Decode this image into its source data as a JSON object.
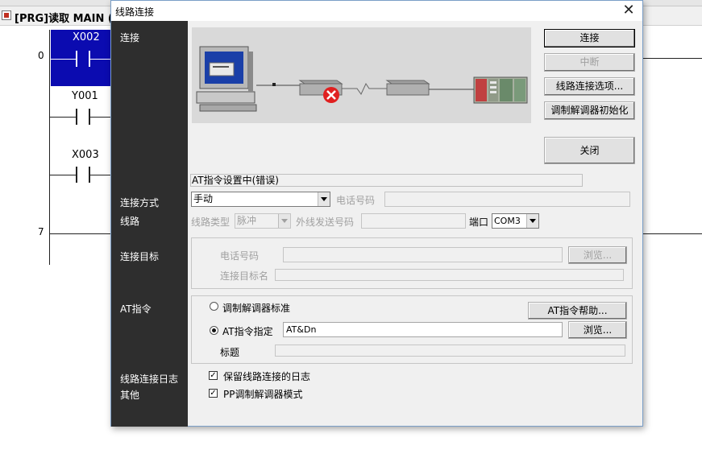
{
  "background_window": {
    "title": "[PRG]读取 MAIN (只",
    "steps": [
      "0",
      "7"
    ],
    "devices": [
      "X002",
      "Y001",
      "X003"
    ]
  },
  "dialog": {
    "title": "线路连接",
    "close_glyph": "✕",
    "side_labels": {
      "connect": "连接",
      "method": "连接方式",
      "line": "线路",
      "target": "连接目标",
      "at_cmd": "AT指令",
      "log": "线路连接日志",
      "other": "其他"
    },
    "buttons": {
      "connect": "连接",
      "interrupt": "中断",
      "line_options": "线路连接选项...",
      "modem_init": "调制解调器初始化",
      "close": "关闭",
      "browse_target": "浏览...",
      "at_help": "AT指令帮助...",
      "browse_at": "浏览..."
    },
    "status_text": "AT指令设置中(错误)",
    "method": {
      "value": "手动",
      "phone_label": "电话号码",
      "phone_value": ""
    },
    "line": {
      "type_label": "线路类型",
      "type_value": "脉冲",
      "outside_label": "外线发送号码",
      "outside_value": "",
      "port_label": "端口",
      "port_value": "COM3"
    },
    "target": {
      "phone_label": "电话号码",
      "phone_value": "",
      "name_label": "连接目标名",
      "name_value": ""
    },
    "at": {
      "option_standard": "调制解调器标准",
      "option_custom": "AT指令指定",
      "custom_value": "AT&Dn",
      "title_label": "标题",
      "title_value": ""
    },
    "options": {
      "keep_log": "保留线路连接的日志",
      "pp_mode": "PP调制解调器模式"
    },
    "colors": {
      "sidebar": "#2e2e2e",
      "selection": "#0b0bb0",
      "error": "#e02020"
    }
  }
}
